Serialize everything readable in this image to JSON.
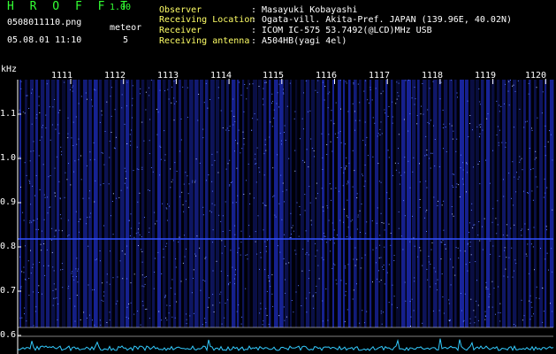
{
  "app": {
    "name": "H R O F F T",
    "version": "1.00"
  },
  "file": {
    "name": "0508011110.png",
    "datetime": "05.08.01 11:10"
  },
  "meteor": {
    "label": "meteor",
    "count": "5"
  },
  "info": [
    {
      "label": "Observer",
      "value": ": Masayuki Kobayashi"
    },
    {
      "label": "Receiving Location",
      "value": ": Ogata-vill. Akita-Pref. JAPAN (139.96E, 40.02N)"
    },
    {
      "label": "Receiver",
      "value": ": ICOM IC-575 53.7492(@LCD)MHz USB"
    },
    {
      "label": "Receiving antenna",
      "value": ": A504HB(yagi 4el)"
    }
  ],
  "axis": {
    "y_unit": "kHz",
    "y_ticks": [
      "1.1",
      "1.0",
      "0.9",
      "0.8",
      "0.7",
      "0.6"
    ],
    "minute_ticks": [
      "1111",
      "1112",
      "1113",
      "1114",
      "1115",
      "1116",
      "1117",
      "1118",
      "1119",
      "1120"
    ]
  },
  "colors": {
    "accent_green": "#33ff33",
    "accent_yellow": "#ffff66",
    "spectrum_blue": "#2a3cff",
    "signal_cyan": "#33ccff"
  }
}
